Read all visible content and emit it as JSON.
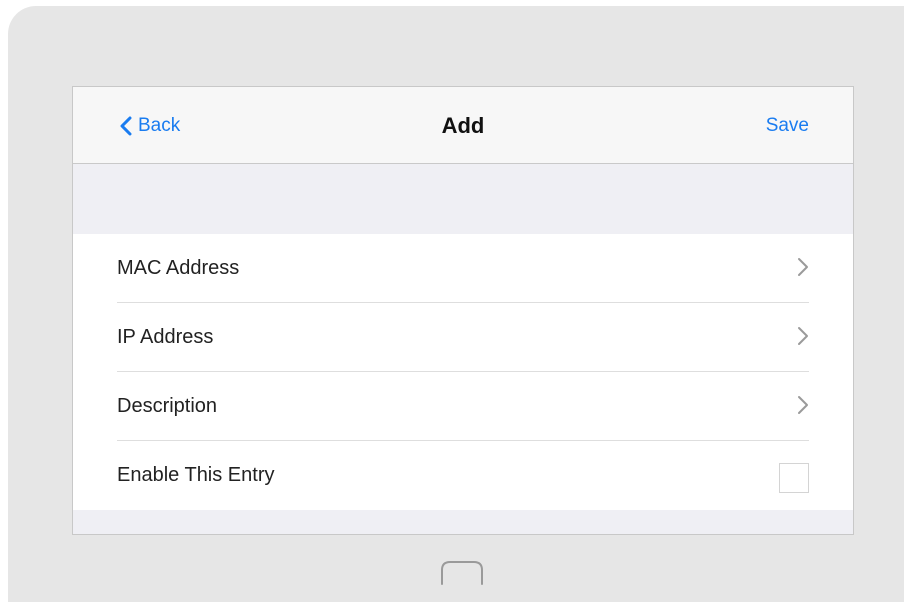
{
  "nav": {
    "back_label": "Back",
    "title": "Add",
    "save_label": "Save"
  },
  "rows": [
    {
      "label": "MAC Address",
      "accessory": "chevron-right-icon"
    },
    {
      "label": "IP Address",
      "accessory": "chevron-right-icon"
    },
    {
      "label": "Description",
      "accessory": "chevron-right-icon"
    },
    {
      "label": "Enable This Entry",
      "accessory": "checkbox",
      "checked": false
    }
  ],
  "colors": {
    "accent": "#1a7cf0",
    "group_background": "#efeff4",
    "device_frame": "#e6e6e6"
  },
  "icons": {
    "back": "chevron-left-icon",
    "row": "chevron-right-icon",
    "home": "home-button-icon"
  }
}
